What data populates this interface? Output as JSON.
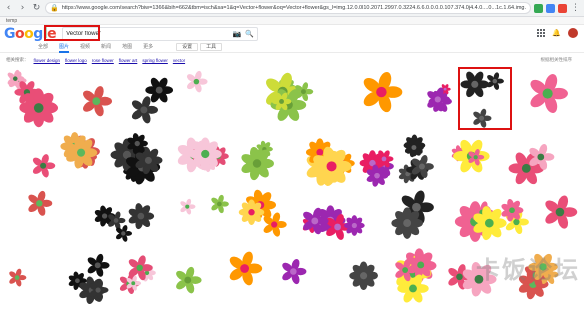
{
  "browser": {
    "url": "https://www.google.com/search?biw=1366&bih=662&tbm=isch&sa=1&q=Vector+flower&oq=Vector+flower&gs_l=img.12.0.0l10.2071.2997.0.3224.6.6.0.0.0.0.107.374.0j4.4.0....0...1c.1.64.img..2.4.3",
    "bookmark_label": "temp"
  },
  "google": {
    "logo": [
      "G",
      "o",
      "o",
      "g",
      "l",
      "e"
    ],
    "query": "Vector flower",
    "tabs": [
      "全部",
      "图片",
      "视频",
      "新闻",
      "地图",
      "更多"
    ],
    "active_tab": "图片",
    "tools": [
      "设置",
      "工具"
    ]
  },
  "related": {
    "label": "相关搜索：",
    "chips": [
      "flower design",
      "flower logo",
      "rose flower",
      "flower art",
      "spring flower",
      "vector"
    ],
    "right": "根据相关性排序"
  },
  "watermark": "卡饭论坛",
  "colors": {
    "accent": "#1a73e8",
    "highlight": "#dd1111"
  }
}
